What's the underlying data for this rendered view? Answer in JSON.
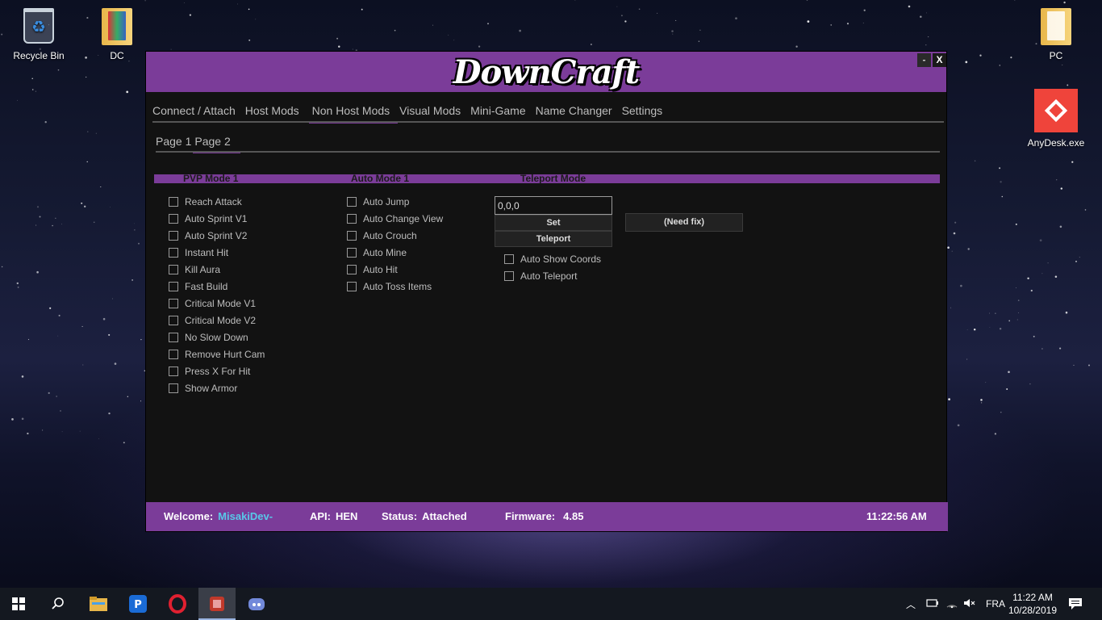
{
  "desktop": {
    "icons": [
      {
        "label": "Recycle Bin"
      },
      {
        "label": "DC"
      },
      {
        "label": "PC"
      },
      {
        "label": "AnyDesk.exe"
      }
    ]
  },
  "window": {
    "title": "DownCraft",
    "minimize_label": "-",
    "close_label": "X",
    "main_tabs": [
      {
        "label": "Connect / Attach"
      },
      {
        "label": "Host Mods"
      },
      {
        "label": "Non Host Mods",
        "active": true
      },
      {
        "label": "Visual Mods"
      },
      {
        "label": "Mini-Game"
      },
      {
        "label": "Name Changer"
      },
      {
        "label": "Settings"
      }
    ],
    "sub_tabs": [
      {
        "label": "Page 1"
      },
      {
        "label": "Page 2",
        "active": true
      }
    ],
    "sections": {
      "pvp": {
        "title": "PVP Mode 1",
        "items": [
          "Reach Attack",
          "Auto Sprint V1",
          "Auto Sprint V2",
          "Instant Hit",
          "Kill Aura",
          "Fast Build",
          "Critical Mode V1",
          "Critical Mode V2",
          "No Slow Down",
          "Remove Hurt Cam",
          "Press X For Hit",
          "Show Armor"
        ]
      },
      "auto": {
        "title": "Auto Mode 1",
        "items": [
          "Auto Jump",
          "Auto Change View",
          "Auto Crouch",
          "Auto Mine",
          "Auto Hit",
          "Auto Toss Items"
        ]
      },
      "teleport": {
        "title": "Teleport Mode",
        "coords_value": "0,0,0",
        "set_label": "Set",
        "teleport_label": "Teleport",
        "need_fix_label": "(Need fix)",
        "items": [
          "Auto Show Coords",
          "Auto Teleport"
        ]
      }
    },
    "status": {
      "welcome_label": "Welcome:",
      "welcome_value": "MisakiDev-",
      "api_label": "API:",
      "api_value": "HEN",
      "status_label": "Status:",
      "status_value": "Attached",
      "firmware_label": "Firmware:",
      "firmware_value": "4.85",
      "time": "11:22:56 AM"
    },
    "colors": {
      "accent": "#7b3c99",
      "background": "#121212",
      "user_text": "#58c8e8"
    }
  },
  "taskbar": {
    "language": "FRA",
    "time": "11:22 AM",
    "date": "10/28/2019"
  }
}
